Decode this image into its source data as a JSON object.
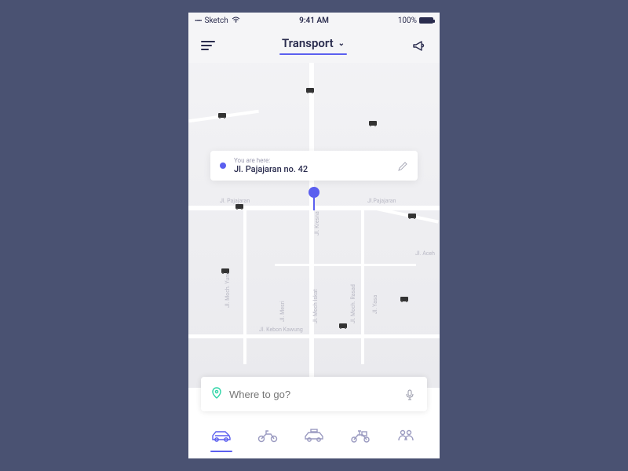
{
  "status": {
    "carrier": "Sketch",
    "time": "9:41 AM",
    "battery": "100%"
  },
  "header": {
    "title": "Transport"
  },
  "location": {
    "label": "You are here:",
    "address": "Jl. Pajajaran no. 42"
  },
  "search": {
    "placeholder": "Where to go?"
  },
  "roads": {
    "pajajaran": "Jl. Pajajaran",
    "pajajaran2": "Jl.Pajajaran",
    "kresna": "Jl. Kresna",
    "aceh": "Jl. Aceh",
    "kebonkawung": "Jl. Kebon Kawung",
    "mochyunus": "Jl. Moch. Yunus",
    "mesri": "Jl. Mesri",
    "mochiskat": "Jl. Moch Iskat",
    "mochrasad": "Jl. Moch. Rasad",
    "yasa": "Jl. Yasa"
  },
  "vehicles": [
    {
      "name": "car",
      "active": true
    },
    {
      "name": "motorbike",
      "active": false
    },
    {
      "name": "taxi",
      "active": false
    },
    {
      "name": "courier",
      "active": false
    },
    {
      "name": "carpool",
      "active": false
    }
  ]
}
